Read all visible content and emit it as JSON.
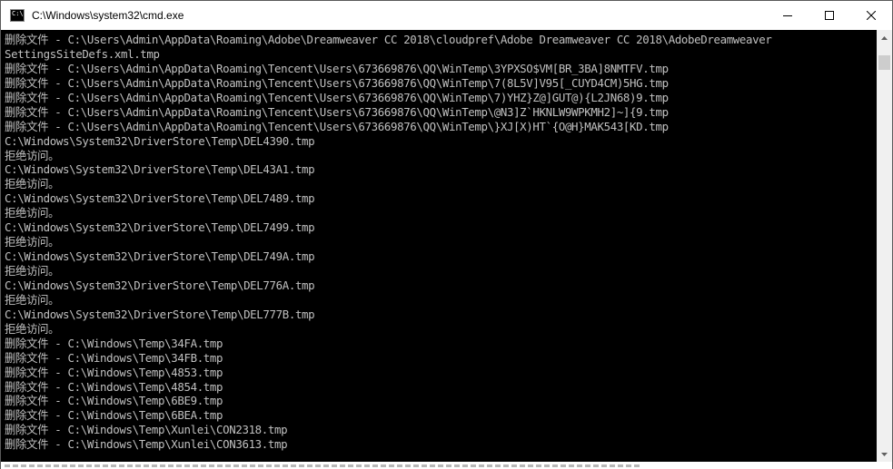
{
  "window": {
    "title": "C:\\Windows\\system32\\cmd.exe",
    "icon": "cmd-app-icon",
    "icon_text": "C:\\",
    "buttons": {
      "minimize": "minimize-icon",
      "maximize": "maximize-icon",
      "close": "close-icon"
    }
  },
  "colors": {
    "console_background": "#000000",
    "console_text": "#c0c0c0",
    "scrollbar_track": "#f0f0f0",
    "scrollbar_thumb": "#cdcdcd"
  },
  "console": {
    "lines": [
      "删除文件 - C:\\Users\\Admin\\AppData\\Roaming\\Adobe\\Dreamweaver CC 2018\\cloudpref\\Adobe Dreamweaver CC 2018\\AdobeDreamweaver",
      "SettingsSiteDefs.xml.tmp",
      "删除文件 - C:\\Users\\Admin\\AppData\\Roaming\\Tencent\\Users\\673669876\\QQ\\WinTemp\\3YPXSO$VM[BR_3BA]8NMTFV.tmp",
      "删除文件 - C:\\Users\\Admin\\AppData\\Roaming\\Tencent\\Users\\673669876\\QQ\\WinTemp\\7(8L5V]V95[_CUYD4CM)5HG.tmp",
      "删除文件 - C:\\Users\\Admin\\AppData\\Roaming\\Tencent\\Users\\673669876\\QQ\\WinTemp\\7)YHZ}Z@]GUT@){L2JN68)9.tmp",
      "删除文件 - C:\\Users\\Admin\\AppData\\Roaming\\Tencent\\Users\\673669876\\QQ\\WinTemp\\@N3]Z`HKNLW9WPKMH2]~]{9.tmp",
      "删除文件 - C:\\Users\\Admin\\AppData\\Roaming\\Tencent\\Users\\673669876\\QQ\\WinTemp\\}XJ[X)HT`{O@H}MAK543[KD.tmp",
      "C:\\Windows\\System32\\DriverStore\\Temp\\DEL4390.tmp",
      "拒绝访问。",
      "C:\\Windows\\System32\\DriverStore\\Temp\\DEL43A1.tmp",
      "拒绝访问。",
      "C:\\Windows\\System32\\DriverStore\\Temp\\DEL7489.tmp",
      "拒绝访问。",
      "C:\\Windows\\System32\\DriverStore\\Temp\\DEL7499.tmp",
      "拒绝访问。",
      "C:\\Windows\\System32\\DriverStore\\Temp\\DEL749A.tmp",
      "拒绝访问。",
      "C:\\Windows\\System32\\DriverStore\\Temp\\DEL776A.tmp",
      "拒绝访问。",
      "C:\\Windows\\System32\\DriverStore\\Temp\\DEL777B.tmp",
      "拒绝访问。",
      "删除文件 - C:\\Windows\\Temp\\34FA.tmp",
      "删除文件 - C:\\Windows\\Temp\\34FB.tmp",
      "删除文件 - C:\\Windows\\Temp\\4853.tmp",
      "删除文件 - C:\\Windows\\Temp\\4854.tmp",
      "删除文件 - C:\\Windows\\Temp\\6BE9.tmp",
      "删除文件 - C:\\Windows\\Temp\\6BEA.tmp",
      "删除文件 - C:\\Windows\\Temp\\Xunlei\\CON2318.tmp",
      "删除文件 - C:\\Windows\\Temp\\Xunlei\\CON3613.tmp"
    ]
  },
  "scrollbar": {
    "up_icon": "scroll-up-arrow-icon",
    "down_icon": "scroll-down-arrow-icon"
  }
}
